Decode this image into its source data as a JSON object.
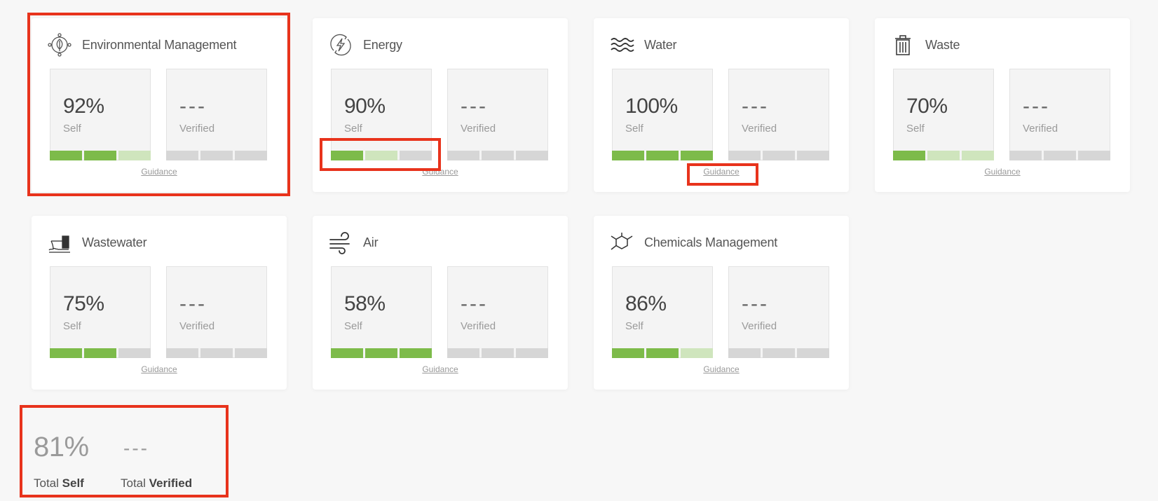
{
  "segment_labels": {
    "full": "complete",
    "partial": "in progress",
    "empty": "not started"
  },
  "colors": {
    "segment_full": "#7dbb4a",
    "segment_partial": "#cfe5bd",
    "segment_empty": "#d6d6d6",
    "highlight": "#e8331c",
    "card_background": "#ffffff",
    "page_background": "#f7f7f7"
  },
  "cards": [
    {
      "icon": "environmental-management-icon",
      "title": "Environmental Management",
      "self": {
        "value": "92%",
        "label": "Self",
        "segments": [
          "full",
          "full",
          "partial"
        ]
      },
      "verified": {
        "value": "---",
        "label": "Verified",
        "segments": [
          "empty",
          "empty",
          "empty"
        ]
      },
      "guidance": "Guidance"
    },
    {
      "icon": "energy-icon",
      "title": "Energy",
      "self": {
        "value": "90%",
        "label": "Self",
        "segments": [
          "full",
          "partial",
          "empty"
        ]
      },
      "verified": {
        "value": "---",
        "label": "Verified",
        "segments": [
          "empty",
          "empty",
          "empty"
        ]
      },
      "guidance": "Guidance"
    },
    {
      "icon": "water-icon",
      "title": "Water",
      "self": {
        "value": "100%",
        "label": "Self",
        "segments": [
          "full",
          "full",
          "full"
        ]
      },
      "verified": {
        "value": "---",
        "label": "Verified",
        "segments": [
          "empty",
          "empty",
          "empty"
        ]
      },
      "guidance": "Guidance"
    },
    {
      "icon": "waste-icon",
      "title": "Waste",
      "self": {
        "value": "70%",
        "label": "Self",
        "segments": [
          "full",
          "partial",
          "partial"
        ]
      },
      "verified": {
        "value": "---",
        "label": "Verified",
        "segments": [
          "empty",
          "empty",
          "empty"
        ]
      },
      "guidance": "Guidance"
    },
    {
      "icon": "wastewater-icon",
      "title": "Wastewater",
      "self": {
        "value": "75%",
        "label": "Self",
        "segments": [
          "full",
          "full",
          "empty"
        ]
      },
      "verified": {
        "value": "---",
        "label": "Verified",
        "segments": [
          "empty",
          "empty",
          "empty"
        ]
      },
      "guidance": "Guidance"
    },
    {
      "icon": "air-icon",
      "title": "Air",
      "self": {
        "value": "58%",
        "label": "Self",
        "segments": [
          "full",
          "full",
          "full"
        ]
      },
      "verified": {
        "value": "---",
        "label": "Verified",
        "segments": [
          "empty",
          "empty",
          "empty"
        ]
      },
      "guidance": "Guidance"
    },
    {
      "icon": "chemicals-management-icon",
      "title": "Chemicals Management",
      "self": {
        "value": "86%",
        "label": "Self",
        "segments": [
          "full",
          "full",
          "partial"
        ]
      },
      "verified": {
        "value": "---",
        "label": "Verified",
        "segments": [
          "empty",
          "empty",
          "empty"
        ]
      },
      "guidance": "Guidance"
    }
  ],
  "totals": {
    "self_value": "81%",
    "verified_value": "---",
    "self_label_prefix": "Total",
    "self_label_emphasis": "Self",
    "verified_label_prefix": "Total",
    "verified_label_emphasis": "Verified"
  }
}
